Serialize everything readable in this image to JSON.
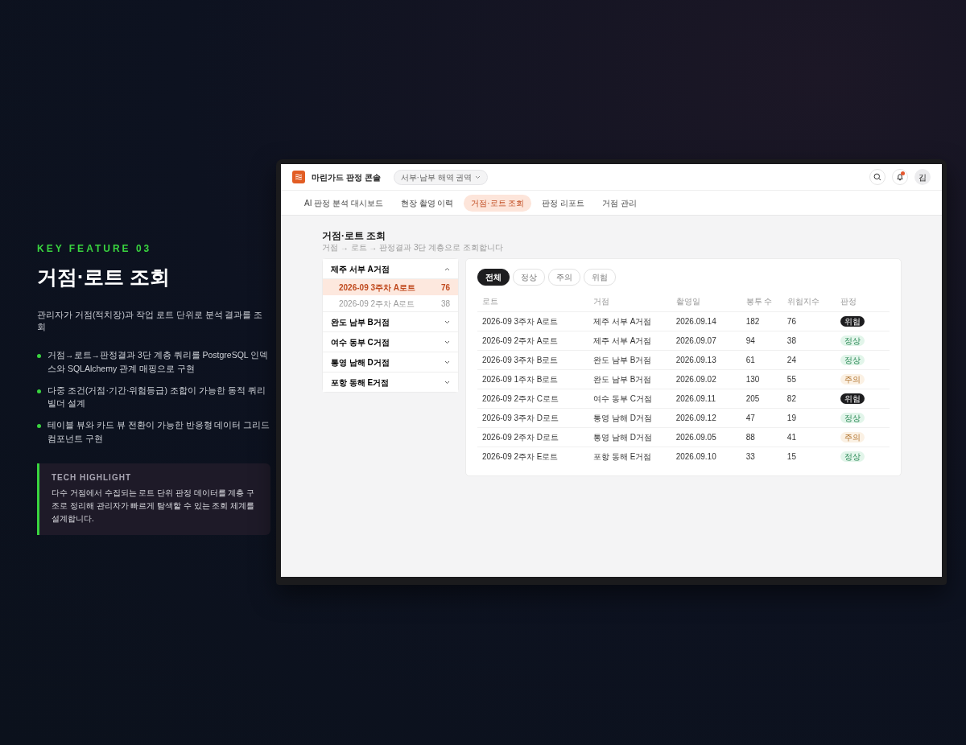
{
  "feature": {
    "eyebrow": "KEY FEATURE 03",
    "title": "거점·로트 조회",
    "subtitle": "관리자가 거점(적치장)과 작업 로트 단위로 분석 결과를 조회",
    "bullets": [
      "거점→로트→판정결과 3단 계층 쿼리를 PostgreSQL 인덱스와 SQLAlchemy 관계 매핑으로 구현",
      "다중 조건(거점·기간·위험등급) 조합이 가능한 동적 쿼리 빌더 설계",
      "테이블 뷰와 카드 뷰 전환이 가능한 반응형 데이터 그리드 컴포넌트 구현"
    ],
    "highlight": {
      "label": "TECH HIGHLIGHT",
      "text": "다수 거점에서 수집되는 로트 단위 판정 데이터를 계층 구조로 정리해 관리자가 빠르게 탐색할 수 있는 조회 체계를 설계합니다."
    }
  },
  "app": {
    "brand": "마린가드 판정 콘솔",
    "region": "서부·남부 해역 권역",
    "has_alert": true,
    "avatar": "김",
    "tabs": [
      {
        "label": "AI 판정 분석 대시보드",
        "selected": false
      },
      {
        "label": "현장 촬영 이력",
        "selected": false
      },
      {
        "label": "거점·로트 조회",
        "selected": true
      },
      {
        "label": "판정 리포트",
        "selected": false
      },
      {
        "label": "거점 관리",
        "selected": false
      }
    ],
    "page_title": "거점·로트 조회",
    "breadcrumb": "거점 → 로트 → 판정결과 3단 계층으로 조회합니다",
    "sites": [
      {
        "name": "제주 서부 A거점",
        "expanded": true,
        "lots": [
          {
            "name": "2026-09 3주차 A로트",
            "score": "76",
            "selected": true
          },
          {
            "name": "2026-09 2주차 A로트",
            "score": "38",
            "selected": false
          }
        ]
      },
      {
        "name": "완도 남부 B거점",
        "expanded": false
      },
      {
        "name": "여수 동부 C거점",
        "expanded": false
      },
      {
        "name": "통영 남해 D거점",
        "expanded": false
      },
      {
        "name": "포항 동해 E거점",
        "expanded": false
      }
    ],
    "filters": [
      {
        "label": "전체",
        "selected": true
      },
      {
        "label": "정상",
        "selected": false
      },
      {
        "label": "주의",
        "selected": false
      },
      {
        "label": "위험",
        "selected": false
      }
    ],
    "columns": [
      "로트",
      "거점",
      "촬영일",
      "봉투 수",
      "위험지수",
      "판정"
    ],
    "rows": [
      {
        "lot": "2026-09 3주차 A로트",
        "site": "제주 서부 A거점",
        "date": "2026.09.14",
        "count": "182",
        "risk": "76",
        "verdict": "위험",
        "kind": "danger"
      },
      {
        "lot": "2026-09 2주차 A로트",
        "site": "제주 서부 A거점",
        "date": "2026.09.07",
        "count": "94",
        "risk": "38",
        "verdict": "정상",
        "kind": "normal"
      },
      {
        "lot": "2026-09 3주차 B로트",
        "site": "완도 남부 B거점",
        "date": "2026.09.13",
        "count": "61",
        "risk": "24",
        "verdict": "정상",
        "kind": "normal"
      },
      {
        "lot": "2026-09 1주차 B로트",
        "site": "완도 남부 B거점",
        "date": "2026.09.02",
        "count": "130",
        "risk": "55",
        "verdict": "주의",
        "kind": "caution"
      },
      {
        "lot": "2026-09 2주차 C로트",
        "site": "여수 동부 C거점",
        "date": "2026.09.11",
        "count": "205",
        "risk": "82",
        "verdict": "위험",
        "kind": "danger"
      },
      {
        "lot": "2026-09 3주차 D로트",
        "site": "통영 남해 D거점",
        "date": "2026.09.12",
        "count": "47",
        "risk": "19",
        "verdict": "정상",
        "kind": "normal"
      },
      {
        "lot": "2026-09 2주차 D로트",
        "site": "통영 남해 D거점",
        "date": "2026.09.05",
        "count": "88",
        "risk": "41",
        "verdict": "주의",
        "kind": "caution"
      },
      {
        "lot": "2026-09 2주차 E로트",
        "site": "포항 동해 E거점",
        "date": "2026.09.10",
        "count": "33",
        "risk": "15",
        "verdict": "정상",
        "kind": "normal"
      }
    ]
  }
}
